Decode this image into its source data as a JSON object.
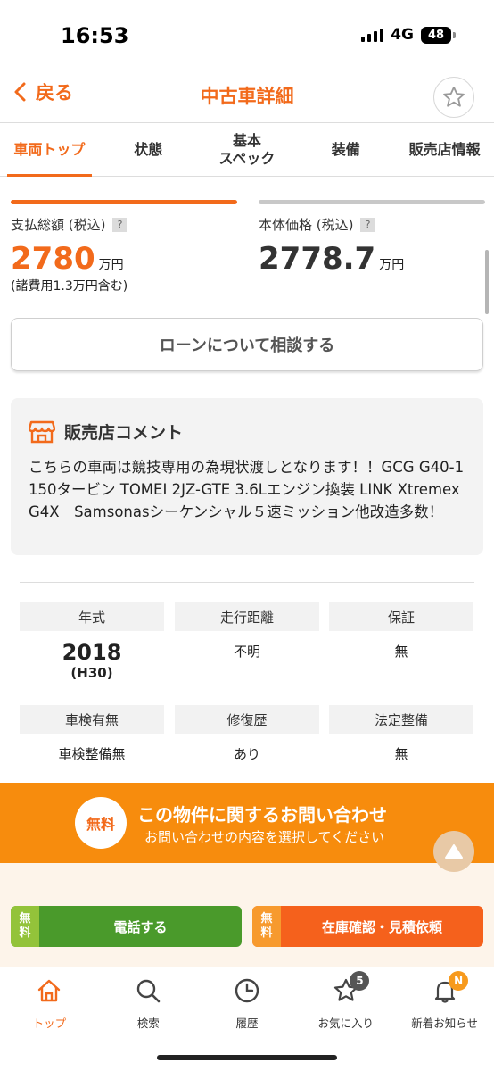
{
  "status": {
    "time": "16:53",
    "network": "4G",
    "battery": "48"
  },
  "header": {
    "back_label": "戻る",
    "title": "中古車詳細"
  },
  "tabs": [
    {
      "label": "車両トップ",
      "active": true
    },
    {
      "label": "状態"
    },
    {
      "label": "基本\nスペック"
    },
    {
      "label": "装備"
    },
    {
      "label": "販売店情報"
    }
  ],
  "price": {
    "total_label": "支払総額 (税込)",
    "total_value": "2780",
    "total_unit": "万円",
    "total_note": "(諸費用1.3万円含む)",
    "body_label": "本体価格 (税込)",
    "body_value": "2778.7",
    "body_unit": "万円",
    "help": "?",
    "accent": "#f26a1b",
    "body_color": "#333333"
  },
  "loan_button": "ローンについて相談する",
  "comment": {
    "title": "販売店コメント",
    "body": "こちらの車両は競技専用の為現状渡しとなります！！GCG G40-1150タービン TOMEI 2JZ-GTE 3.6Lエンジン換装 LINK XtremexG4X　Samsonasシーケンシャル５速ミッション他改造多数！"
  },
  "specs": {
    "year_label": "年式",
    "year_value": "2018",
    "year_sub": "(H30)",
    "mileage_label": "走行距離",
    "mileage_value": "不明",
    "warranty_label": "保証",
    "warranty_value": "無",
    "inspection_label": "車検有無",
    "inspection_value": "車検整備無",
    "repair_label": "修復歴",
    "repair_value": "あり",
    "maintenance_label": "法定整備",
    "maintenance_value": "無"
  },
  "inquiry": {
    "free_badge": "無料",
    "title": "この物件に関するお問い合わせ",
    "subtitle": "お問い合わせの内容を選択してください",
    "color": "#f78c0d"
  },
  "cta": {
    "free_tag_top": "無",
    "free_tag_bottom": "料",
    "phone_label": "電話する",
    "estimate_label": "在庫確認・見積依頼"
  },
  "bottom_nav": {
    "home": "トップ",
    "search": "検索",
    "history": "履歴",
    "favorites": "お気に入り",
    "favorites_badge": "5",
    "news": "新着お知らせ",
    "news_badge": "N"
  }
}
